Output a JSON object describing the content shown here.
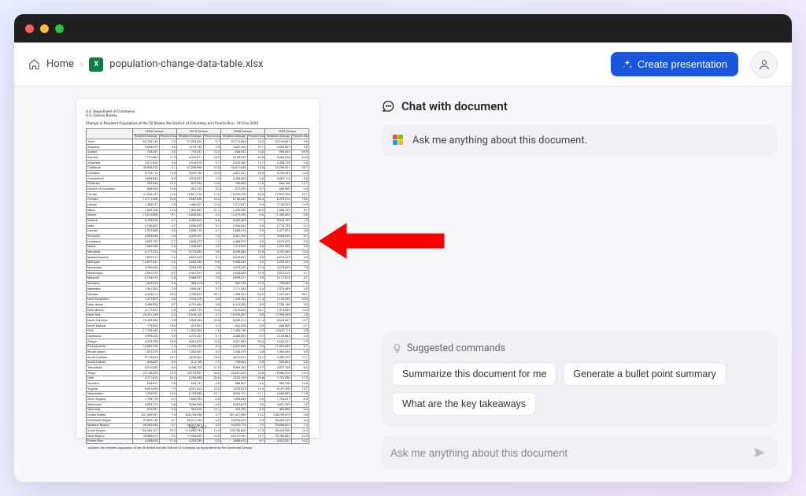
{
  "breadcrumb": {
    "home": "Home",
    "file": "population-change-data-table.xlsx"
  },
  "actions": {
    "create": "Create presentation"
  },
  "chat": {
    "title": "Chat with document",
    "greeting": "Ask me anything about this document.",
    "suggested_label": "Suggested commands",
    "suggestions": [
      "Summarize this document for me",
      "Generate a bullet point summary",
      "What are the key takeaways"
    ],
    "placeholder": "Ask me anything about this document"
  },
  "document": {
    "dept1": "U.S. Department of Commerce",
    "dept2": "U.S. Census Bureau",
    "title": "Change in Resident Population of the 50 States, the District of Columbia, and Puerto Rico: 1910 to 2020",
    "group_headers": [
      "2020 Census",
      "2010 Census",
      "2000 Census",
      "1990 Census"
    ],
    "sub_headers": [
      "Area",
      "Resident Change",
      "Percent Change",
      "Resident Change",
      "Percent Change",
      "Resident Change",
      "Percent Change",
      "Resident Change",
      "Percent Change"
    ],
    "rows": [
      [
        "Total",
        "22,703,743",
        "7.4",
        "27,323,632",
        "9.7",
        "32,712,033",
        "13.2",
        "22,164,837",
        "9.8"
      ],
      [
        "Alabama",
        "5,024,279",
        "5.0",
        "4,779,736",
        "7.5",
        "4,447,100",
        "10.1",
        "4,040,587",
        "3.8"
      ],
      [
        "Alaska",
        "733,391",
        "3.0",
        "710,231",
        "13.3",
        "626,932",
        "14.0",
        "550,043",
        "36.9"
      ],
      [
        "Arizona",
        "7,151,502",
        "11.9",
        "6,392,017",
        "24.6",
        "5,130,632",
        "40.0",
        "3,665,228",
        "34.8"
      ],
      [
        "Arkansas",
        "3,011,524",
        "3.3",
        "2,915,918",
        "9.1",
        "2,673,400",
        "13.7",
        "2,350,725",
        "2.8"
      ],
      [
        "California",
        "39,538,223",
        "6.1",
        "37,253,956",
        "10.0",
        "33,871,648",
        "13.8",
        "29,760,021",
        "25.7"
      ],
      [
        "Colorado",
        "5,773,714",
        "14.8",
        "5,029,196",
        "16.9",
        "4,301,261",
        "30.6",
        "3,294,394",
        "14.0"
      ],
      [
        "Connecticut",
        "3,605,944",
        "0.9",
        "3,574,097",
        "4.9",
        "3,405,565",
        "3.6",
        "3,287,116",
        "5.8"
      ],
      [
        "Delaware",
        "989,948",
        "10.2",
        "897,934",
        "14.6",
        "783,600",
        "17.6",
        "666,168",
        "12.1"
      ],
      [
        "District of Columbia",
        "689,545",
        "14.6",
        "601,723",
        "5.2",
        "572,059",
        "-5.7",
        "606,900",
        "-4.9"
      ],
      [
        "Florida",
        "21,538,187",
        "14.6",
        "18,801,310",
        "17.6",
        "15,982,378",
        "23.5",
        "12,937,926",
        "32.7"
      ],
      [
        "Georgia",
        "10,711,908",
        "10.6",
        "9,687,653",
        "18.3",
        "8,186,453",
        "26.4",
        "6,478,216",
        "18.6"
      ],
      [
        "Hawaii",
        "1,455,271",
        "7.0",
        "1,360,301",
        "12.3",
        "1,211,537",
        "9.3",
        "1,108,229",
        "14.9"
      ],
      [
        "Idaho",
        "1,839,106",
        "17.3",
        "1,567,582",
        "21.1",
        "1,293,953",
        "28.5",
        "1,006,749",
        "6.7"
      ],
      [
        "Illinois",
        "12,812,508",
        "-0.1",
        "12,830,632",
        "3.3",
        "12,419,293",
        "8.6",
        "11,430,602",
        "0.0"
      ],
      [
        "Indiana",
        "6,785,528",
        "4.7",
        "6,483,802",
        "6.6",
        "6,080,485",
        "9.7",
        "5,544,159",
        "1.0"
      ],
      [
        "Iowa",
        "3,190,369",
        "4.7",
        "3,046,355",
        "4.1",
        "2,926,324",
        "5.4",
        "2,776,755",
        "-4.7"
      ],
      [
        "Kansas",
        "2,937,880",
        "3.0",
        "2,853,118",
        "6.1",
        "2,688,418",
        "8.5",
        "2,477,574",
        "4.8"
      ],
      [
        "Kentucky",
        "4,505,836",
        "3.8",
        "4,339,367",
        "7.4",
        "4,041,769",
        "9.7",
        "3,685,296",
        "0.7"
      ],
      [
        "Louisiana",
        "4,657,757",
        "2.7",
        "4,533,372",
        "1.4",
        "4,468,976",
        "5.9",
        "4,219,973",
        "0.3"
      ],
      [
        "Maine",
        "1,362,359",
        "2.6",
        "1,328,361",
        "4.2",
        "1,274,923",
        "3.8",
        "1,227,928",
        "9.2"
      ],
      [
        "Maryland",
        "6,177,224",
        "7.0",
        "5,773,552",
        "9.0",
        "5,296,486",
        "10.8",
        "4,781,468",
        "13.4"
      ],
      [
        "Massachusetts",
        "7,029,917",
        "7.4",
        "6,547,629",
        "3.1",
        "6,349,097",
        "5.5",
        "6,016,425",
        "4.9"
      ],
      [
        "Michigan",
        "10,077,331",
        "2.0",
        "9,883,640",
        "-0.6",
        "9,938,444",
        "6.9",
        "9,295,297",
        "0.4"
      ],
      [
        "Minnesota",
        "5,706,494",
        "7.6",
        "5,303,925",
        "7.8",
        "4,919,479",
        "12.4",
        "4,375,099",
        "7.3"
      ],
      [
        "Mississippi",
        "2,961,279",
        "-0.2",
        "2,967,297",
        "4.3",
        "2,844,658",
        "10.5",
        "2,573,216",
        "2.1"
      ],
      [
        "Missouri",
        "6,154,913",
        "2.8",
        "5,988,927",
        "7.0",
        "5,595,211",
        "9.3",
        "5,117,073",
        "4.1"
      ],
      [
        "Montana",
        "1,084,225",
        "9.6",
        "989,415",
        "9.7",
        "902,195",
        "12.9",
        "799,065",
        "1.6"
      ],
      [
        "Nebraska",
        "1,961,504",
        "7.4",
        "1,826,341",
        "6.7",
        "1,711,263",
        "8.4",
        "1,578,385",
        "0.5"
      ],
      [
        "Nevada",
        "3,104,614",
        "15.0",
        "2,700,551",
        "35.1",
        "1,998,257",
        "66.3",
        "1,201,833",
        "50.1"
      ],
      [
        "New Hampshire",
        "1,377,529",
        "4.6",
        "1,316,470",
        "6.5",
        "1,235,786",
        "11.4",
        "1,109,252",
        "20.5"
      ],
      [
        "New Jersey",
        "9,288,994",
        "5.7",
        "8,791,894",
        "4.5",
        "8,414,350",
        "8.9",
        "7,730,188",
        "5.0"
      ],
      [
        "New Mexico",
        "2,117,522",
        "2.8",
        "2,059,179",
        "13.2",
        "1,819,046",
        "20.1",
        "1,515,069",
        "16.3"
      ],
      [
        "New York",
        "20,201,249",
        "4.2",
        "19,378,102",
        "2.1",
        "18,976,457",
        "5.5",
        "17,990,455",
        "2.5"
      ],
      [
        "North Carolina",
        "10,439,388",
        "9.5",
        "9,535,483",
        "18.5",
        "8,049,313",
        "21.4",
        "6,628,637",
        "12.7"
      ],
      [
        "North Dakota",
        "779,094",
        "15.8",
        "672,591",
        "4.7",
        "642,200",
        "0.5",
        "638,800",
        "-2.1"
      ],
      [
        "Ohio",
        "11,799,448",
        "2.3",
        "11,536,504",
        "1.6",
        "11,353,140",
        "4.7",
        "10,847,115",
        "0.5"
      ],
      [
        "Oklahoma",
        "3,959,353",
        "5.5",
        "3,751,351",
        "8.7",
        "3,450,654",
        "9.7",
        "3,145,585",
        "4.0"
      ],
      [
        "Oregon",
        "4,237,256",
        "10.6",
        "3,831,074",
        "12.0",
        "3,421,399",
        "20.4",
        "2,842,321",
        "7.9"
      ],
      [
        "Pennsylvania",
        "13,002,700",
        "2.4",
        "12,702,379",
        "3.4",
        "12,281,054",
        "3.4",
        "11,881,643",
        "0.1"
      ],
      [
        "Rhode Island",
        "1,097,379",
        "4.3",
        "1,052,567",
        "0.4",
        "1,048,319",
        "4.5",
        "1,003,464",
        "5.9"
      ],
      [
        "South Carolina",
        "5,118,425",
        "10.7",
        "4,625,364",
        "15.3",
        "4,012,012",
        "15.1",
        "3,486,703",
        "11.7"
      ],
      [
        "South Dakota",
        "886,667",
        "8.9",
        "814,180",
        "7.9",
        "754,844",
        "8.5",
        "696,004",
        "0.8"
      ],
      [
        "Tennessee",
        "6,910,840",
        "8.9",
        "6,346,105",
        "11.5",
        "5,689,283",
        "16.7",
        "4,877,185",
        "6.2"
      ],
      [
        "Texas",
        "29,145,505",
        "15.9",
        "25,145,561",
        "20.6",
        "20,851,820",
        "22.8",
        "16,986,510",
        "19.4"
      ],
      [
        "Utah",
        "3,271,616",
        "18.4",
        "2,763,885",
        "23.8",
        "2,233,169",
        "29.6",
        "1,722,850",
        "17.9"
      ],
      [
        "Vermont",
        "643,077",
        "2.8",
        "625,741",
        "2.8",
        "608,827",
        "8.2",
        "562,758",
        "10.0"
      ],
      [
        "Virginia",
        "8,631,393",
        "7.9",
        "8,001,024",
        "13.0",
        "7,078,515",
        "14.4",
        "6,187,358",
        "15.7"
      ],
      [
        "Washington",
        "7,705,281",
        "14.6",
        "6,724,540",
        "14.1",
        "5,894,121",
        "21.1",
        "4,866,692",
        "17.8"
      ],
      [
        "West Virginia",
        "1,793,716",
        "-3.2",
        "1,852,994",
        "2.5",
        "1,808,344",
        "0.8",
        "1,793,477",
        "-8.0"
      ],
      [
        "Wisconsin",
        "5,893,718",
        "3.6",
        "5,686,986",
        "6.0",
        "5,363,675",
        "9.6",
        "4,891,769",
        "4.0"
      ],
      [
        "Wyoming",
        "576,851",
        "2.3",
        "563,626",
        "14.1",
        "493,782",
        "8.9",
        "453,588",
        "-3.4"
      ],
      [
        "United States",
        "331,449,281",
        "7.4",
        "308,745,538",
        "9.7",
        "281,421,906",
        "13.2",
        "248,709,873",
        "9.8"
      ],
      [
        "Northeast Region",
        "57,609,148",
        "4.1",
        "55,317,240",
        "3.2",
        "53,594,378",
        "5.5",
        "50,809,229",
        "3.4"
      ],
      [
        "Midwest Region",
        "68,985,454",
        "3.1",
        "66,927,001",
        "3.9",
        "64,392,776",
        "7.9",
        "59,668,632",
        "1.4"
      ],
      [
        "South Region",
        "126,266,107",
        "10.2",
        "114,555,744",
        "14.3",
        "100,236,820",
        "17.3",
        "85,445,930",
        "13.4"
      ],
      [
        "West Region",
        "78,588,572",
        "9.2",
        "71,945,553",
        "13.8",
        "63,197,932",
        "19.7",
        "52,786,082",
        "22.3"
      ],
      [
        "Puerto Rico",
        "3,285,874",
        "-11.8",
        "3,725,789",
        "-2.2",
        "3,808,610",
        "8.1",
        "3,522,037",
        "10.2"
      ]
    ],
    "footnote": "¹ Includes the resident population of the 50 states and the District of Columbia, as ascertained by the Decennial Census.",
    "page_label": "Page 1 of 3"
  }
}
